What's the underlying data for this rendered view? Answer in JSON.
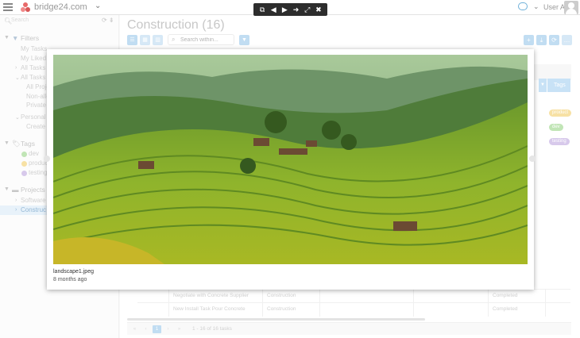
{
  "topbar": {
    "brand": "bridge24.com",
    "user_name": "User A"
  },
  "viewer_toolbar": {
    "buttons": [
      {
        "icon": "external-link-icon",
        "glyph": "⧉"
      },
      {
        "icon": "arrow-left-icon",
        "glyph": "◀"
      },
      {
        "icon": "play-icon",
        "glyph": "▶"
      },
      {
        "icon": "arrow-right-icon",
        "glyph": "➜"
      },
      {
        "icon": "fullscreen-icon",
        "glyph": "⤢"
      },
      {
        "icon": "close-icon",
        "glyph": "✖"
      }
    ]
  },
  "sidebar": {
    "search_placeholder": "Search",
    "filters_label": "Filters",
    "my_tasks": "My Tasks",
    "my_liked": "My Liked",
    "all_tasks_a": "All Tasks a",
    "all_tasks": "All Tasks",
    "all_projects": "All Proje",
    "non_allocated": "Non-allo",
    "private": "Private F",
    "personal": "Personal F",
    "create_new": "Create n",
    "tags_label": "Tags",
    "tags": [
      {
        "label": "dev",
        "color": "#8fcf7a"
      },
      {
        "label": "produc",
        "color": "#f0c95a"
      },
      {
        "label": "testing",
        "color": "#b79ddb"
      }
    ],
    "projects_label": "Projects",
    "software": "Software",
    "construction": "Construc"
  },
  "main": {
    "title": "Construction (16)",
    "search_placeholder": "Search within...",
    "tags_header": "Tags",
    "tag_pills": [
      {
        "label": "product",
        "color": "#f0c95a"
      },
      {
        "label": "dev",
        "color": "#8fcf7a"
      },
      {
        "label": "testing",
        "color": "#b79ddb"
      }
    ],
    "rows": [
      {
        "task": "Negotiate with Concrete Supplier",
        "project": "Construction",
        "status": "Completed"
      },
      {
        "task": "New Install Task Pour Concrete",
        "project": "Construction",
        "status": "Completed"
      }
    ],
    "pager": {
      "first": "«",
      "prev": "‹",
      "current": "1",
      "next": "›",
      "last": "»",
      "info": "1 - 16 of 16 tasks"
    }
  },
  "modal": {
    "filename": "landscape1.jpeg",
    "date": "8 months ago"
  },
  "colors": {
    "accent": "#8ec1e8",
    "viewer_toolbar_bg": "#2d2d2d"
  }
}
